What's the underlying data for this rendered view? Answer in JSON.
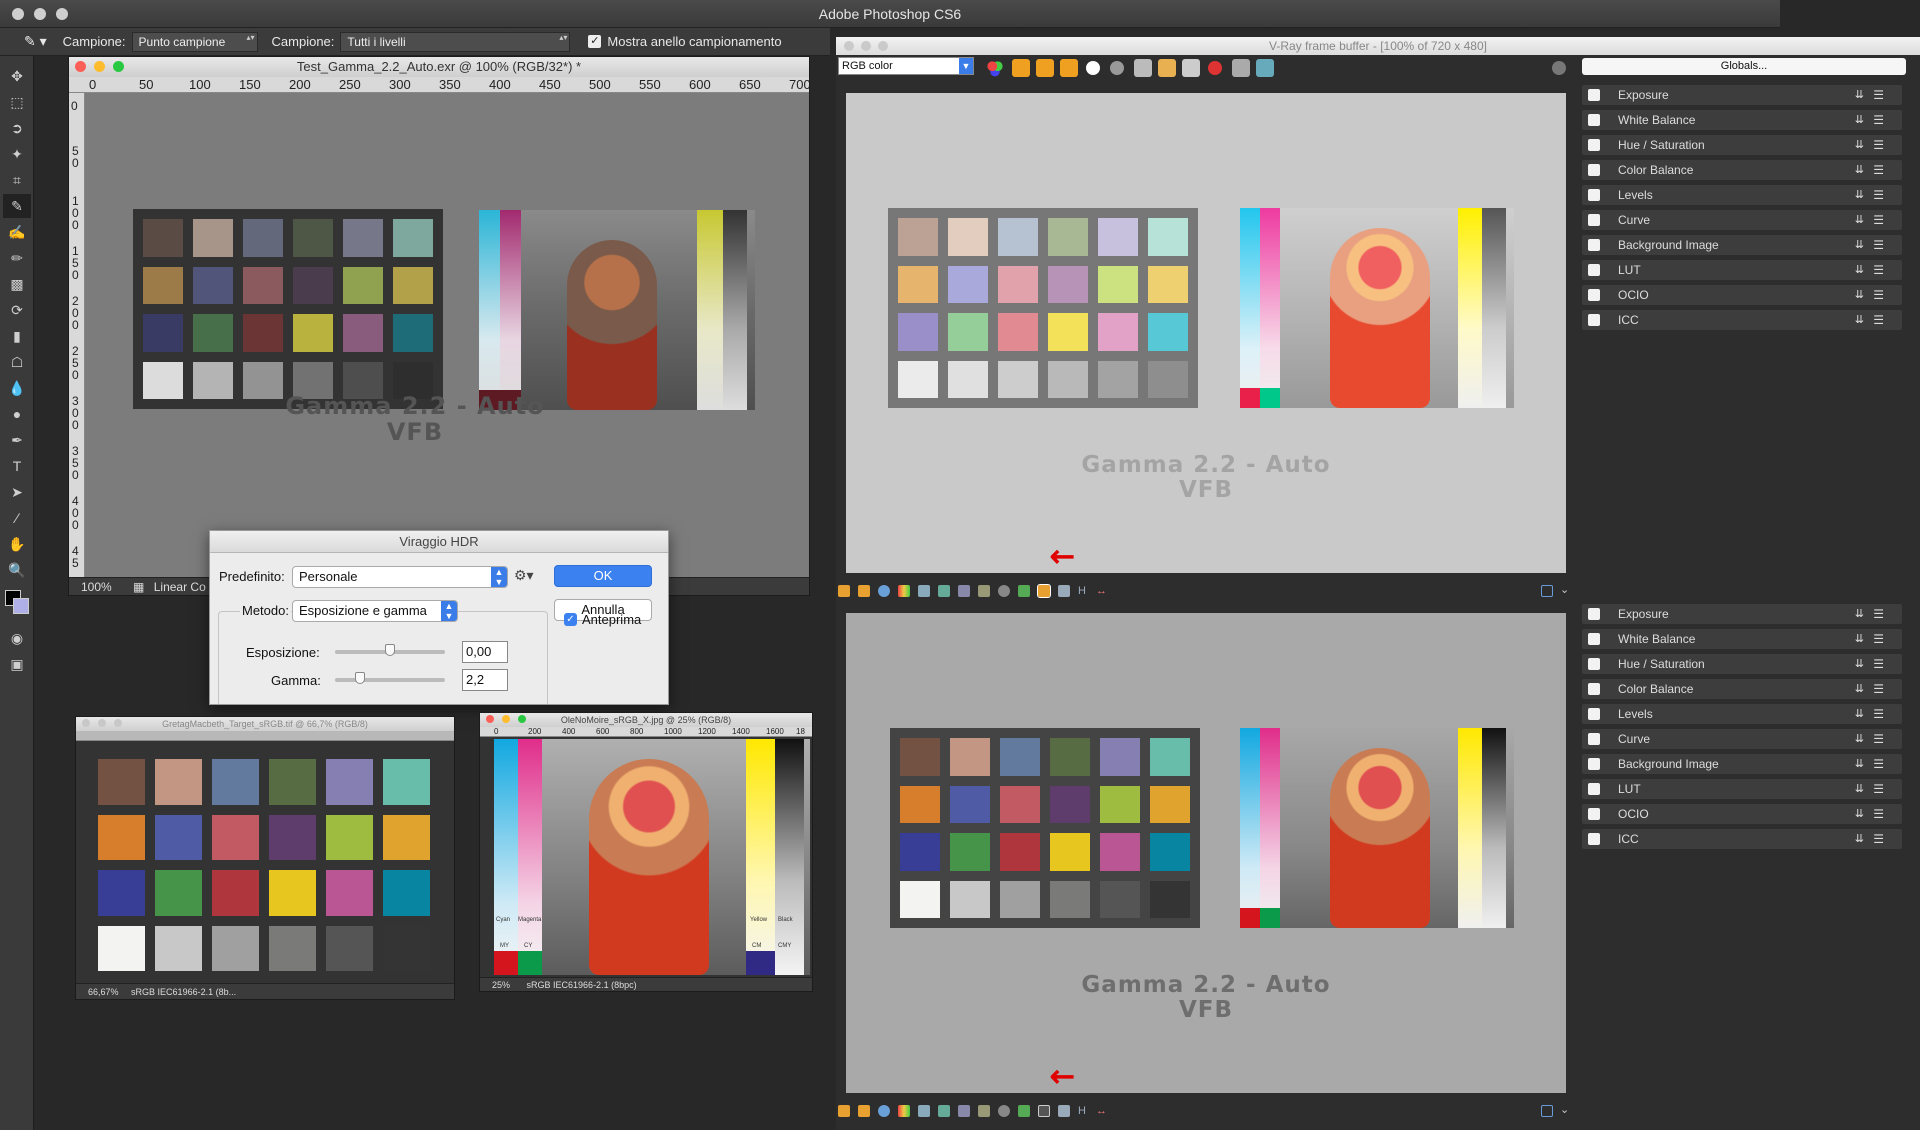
{
  "app": {
    "title": "Adobe Photoshop CS6"
  },
  "options_bar": {
    "label1": "Campione:",
    "value1": "Punto campione",
    "label2": "Campione:",
    "value2": "Tutti i livelli",
    "checkbox_label": "Mostra anello campionamento",
    "checkbox_checked": true
  },
  "doc_main": {
    "title": "Test_Gamma_2.2_Auto.exr @ 100% (RGB/32*) *",
    "ruler_h": [
      "0",
      "50",
      "100",
      "150",
      "200",
      "250",
      "300",
      "350",
      "400",
      "450",
      "500",
      "550",
      "600",
      "650",
      "700"
    ],
    "ruler_v": [
      "0",
      "5 0",
      "1 0 0",
      "1 5 0",
      "2 0 0",
      "2 5 0",
      "3 0 0",
      "3 5 0",
      "4 0 0",
      "4 5"
    ],
    "text_line1": "Gamma 2.2 - Auto",
    "text_line2": "VFB",
    "zoom": "100%",
    "status": "Linear Co"
  },
  "dialog": {
    "title": "Viraggio HDR",
    "preset_label": "Predefinito:",
    "preset_value": "Personale",
    "ok": "OK",
    "cancel": "Annulla",
    "method_label": "Metodo:",
    "method_value": "Esposizione e gamma",
    "preview_label": "Anteprima",
    "preview_checked": true,
    "exposure_label": "Esposizione:",
    "exposure_value": "0,00",
    "exposure_level": 0.5,
    "gamma_label": "Gamma:",
    "gamma_value": "2,2",
    "gamma_level": 0.2
  },
  "doc_macbeth": {
    "title": "GretagMacbeth_Target_sRGB.tif @ 66,7% (RGB/8)",
    "zoom": "66,67%",
    "status": "sRGB IEC61966-2.1 (8b..."
  },
  "doc_ole": {
    "title": "OleNoMoire_sRGB_X.jpg @ 25% (RGB/8)",
    "ruler_h": [
      "0",
      "200",
      "400",
      "600",
      "800",
      "1000",
      "1200",
      "1400",
      "1600",
      "18"
    ],
    "zoom": "25%",
    "status": "sRGB IEC61966-2.1 (8bpc)",
    "strip_labels": [
      "Cyan",
      "Magenta",
      "MY",
      "CY",
      "Yellow",
      "Black",
      "CM",
      "CMY"
    ]
  },
  "vfb": {
    "title": "V-Ray frame buffer - [100% of 720 x 480]",
    "channel_select": "RGB color",
    "globals_button": "Globals...",
    "top_text_line1": "Gamma 2.2 - Auto",
    "top_text_line2": "VFB",
    "bottom_text_line1": "Gamma 2.2 - Auto",
    "bottom_text_line2": "VFB",
    "layers_top": [
      "Exposure",
      "White Balance",
      "Hue / Saturation",
      "Color Balance",
      "Levels",
      "Curve",
      "Background Image",
      "LUT",
      "OCIO",
      "ICC"
    ],
    "layers_bottom": [
      "Exposure",
      "White Balance",
      "Hue / Saturation",
      "Color Balance",
      "Levels",
      "Curve",
      "Background Image",
      "LUT",
      "OCIO",
      "ICC"
    ]
  },
  "colors": {
    "macbeth_srgb": [
      "#735244",
      "#c29682",
      "#627a9d",
      "#576c43",
      "#8580b1",
      "#67bdaa",
      "#d67e2c",
      "#505ba6",
      "#c15a63",
      "#5e3c6c",
      "#9dbc40",
      "#e0a32e",
      "#383d96",
      "#469449",
      "#af363c",
      "#e7c71f",
      "#bb5695",
      "#0885a1",
      "#f3f3f2",
      "#c8c8c8",
      "#a0a0a0",
      "#7a7a79",
      "#555555",
      "#343434"
    ],
    "macbeth_gray": [
      "#5a4c44",
      "#a8958a",
      "#63697a",
      "#4e5646",
      "#77778a",
      "#7ea89e",
      "#9c7b48",
      "#51557a",
      "#8b5a5e",
      "#4a3b4d",
      "#90a250",
      "#b3a14a",
      "#3a3b64",
      "#466f4a",
      "#6a3534",
      "#b9b23e",
      "#895b7c",
      "#1f6c79",
      "#dcdcdc",
      "#b4b4b4",
      "#939393",
      "#727272",
      "#4e4e4e",
      "#2e2e2e"
    ],
    "macbeth_light": [
      "#bba294",
      "#e2cdbf",
      "#b6c1d2",
      "#a8b894",
      "#c7c1de",
      "#b7e2d8",
      "#e6b46c",
      "#a9a9dc",
      "#e2a2ab",
      "#b793b8",
      "#cce17f",
      "#eed070",
      "#9b8fc9",
      "#96ce99",
      "#e18a92",
      "#f3e259",
      "#e2a2c7",
      "#56c8d6",
      "#ebebeb",
      "#e0e0e0",
      "#cdcdcd",
      "#b9b9b9",
      "#a3a3a3",
      "#8e8e8e"
    ]
  }
}
